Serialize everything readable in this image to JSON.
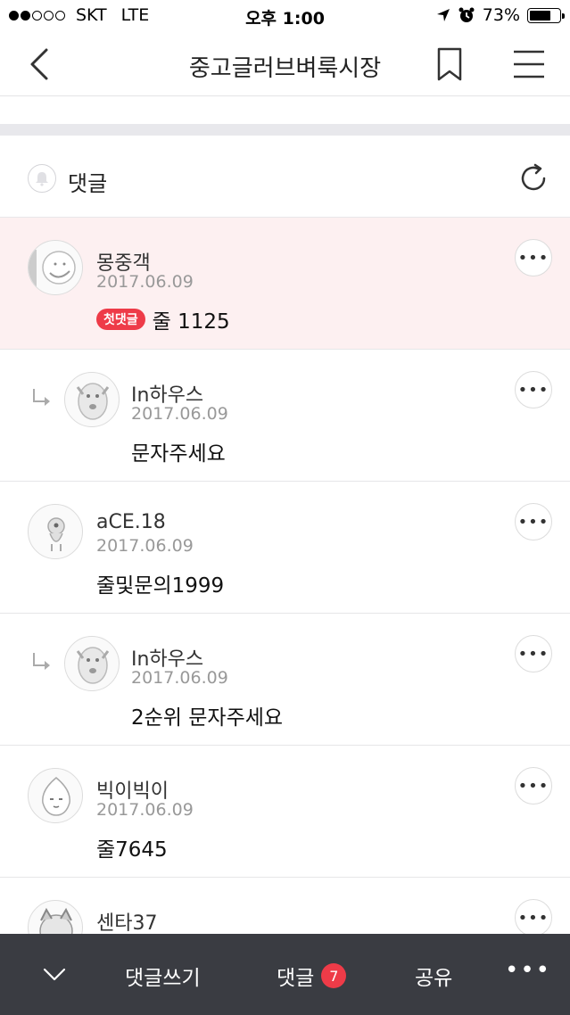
{
  "status": {
    "carrier": "SKT",
    "network": "LTE",
    "time": "오후 1:00",
    "battery": "73%",
    "battery_level": 0.73
  },
  "nav": {
    "title": "중고글러브벼룩시장"
  },
  "comments_header": {
    "title": "댓글"
  },
  "comments": [
    {
      "nick": "몽중객",
      "date": "2017.06.09",
      "badge": "첫댓글",
      "text": "줄 1125",
      "reply": false
    },
    {
      "nick": "In하우스",
      "date": "2017.06.09",
      "text": "문자주세요",
      "reply": true
    },
    {
      "nick": "aCE.18",
      "date": "2017.06.09",
      "text": "줄및문의1999",
      "reply": false
    },
    {
      "nick": "In하우스",
      "date": "2017.06.09",
      "text": "2순위 문자주세요",
      "reply": true
    },
    {
      "nick": "빅이빅이",
      "date": "2017.06.09",
      "text": "줄7645",
      "reply": false
    },
    {
      "nick": "센타37",
      "date": "",
      "text": "",
      "reply": false
    }
  ],
  "bottom_bar": {
    "write_label": "댓글쓰기",
    "comment_label": "댓글",
    "comment_count": "7",
    "share_label": "공유"
  },
  "colors": {
    "accent": "#ee3b48",
    "highlight_bg": "#fdf0f1",
    "bottom_bar_bg": "#3a3c42"
  }
}
